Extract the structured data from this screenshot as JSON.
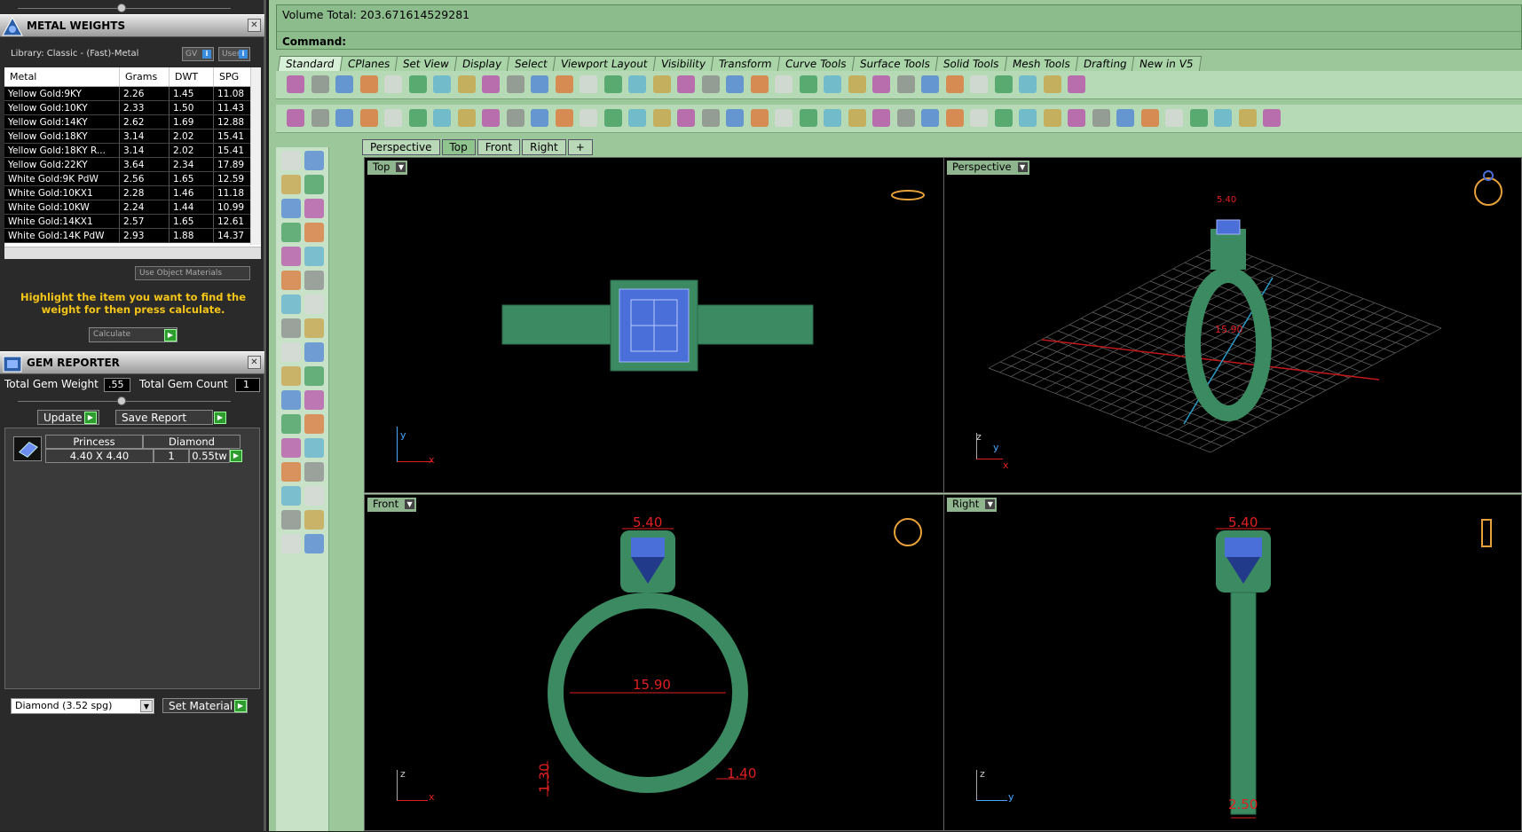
{
  "metal_panel": {
    "title": "METAL WEIGHTS",
    "library": "Library: Classic - (Fast)-Metal",
    "gv_label": "GV",
    "user_label": "User",
    "columns": [
      "Metal",
      "Grams",
      "DWT",
      "SPG"
    ],
    "rows": [
      [
        "Yellow Gold:9KY",
        "2.26",
        "1.45",
        "11.08"
      ],
      [
        "Yellow Gold:10KY",
        "2.33",
        "1.50",
        "11.43"
      ],
      [
        "Yellow Gold:14KY",
        "2.62",
        "1.69",
        "12.88"
      ],
      [
        "Yellow Gold:18KY",
        "3.14",
        "2.02",
        "15.41"
      ],
      [
        "Yellow Gold:18KY R...",
        "3.14",
        "2.02",
        "15.41"
      ],
      [
        "Yellow Gold:22KY",
        "3.64",
        "2.34",
        "17.89"
      ],
      [
        "White Gold:9K PdW",
        "2.56",
        "1.65",
        "12.59"
      ],
      [
        "White Gold:10KX1",
        "2.28",
        "1.46",
        "11.18"
      ],
      [
        "White Gold:10KW",
        "2.24",
        "1.44",
        "10.99"
      ],
      [
        "White Gold:14KX1",
        "2.57",
        "1.65",
        "12.61"
      ],
      [
        "White Gold:14K PdW",
        "2.93",
        "1.88",
        "14.37"
      ]
    ],
    "use_object_materials": "Use Object Materials",
    "hint": "Highlight the item you want to find the weight for then press calculate.",
    "calculate": "Calculate"
  },
  "gem_panel": {
    "title": "GEM REPORTER",
    "total_weight_label": "Total Gem Weight",
    "total_weight": ".55",
    "total_count_label": "Total Gem Count",
    "total_count": "1",
    "update": "Update",
    "save_report": "Save Report",
    "gem": {
      "shape": "Princess",
      "size": "4.40 X 4.40",
      "material": "Diamond",
      "count": "1",
      "tw": "0.55tw"
    },
    "material_select": "Diamond     (3.52 spg)",
    "set_material": "Set Material"
  },
  "command": {
    "volume": "Volume Total: 203.671614529281",
    "prompt": "Command:"
  },
  "toolbar_tabs": [
    "Standard",
    "CPlanes",
    "Set View",
    "Display",
    "Select",
    "Viewport Layout",
    "Visibility",
    "Transform",
    "Curve Tools",
    "Surface Tools",
    "Solid Tools",
    "Mesh Tools",
    "Drafting",
    "New in V5"
  ],
  "viewport_tabs": [
    "Perspective",
    "Top",
    "Front",
    "Right",
    "+"
  ],
  "viewports": {
    "top": {
      "label": "Top"
    },
    "perspective": {
      "label": "Perspective",
      "dims": [
        "5.40",
        "15.90"
      ]
    },
    "front": {
      "label": "Front",
      "dims": [
        "5.40",
        "15.90",
        "1.30",
        "1.40"
      ]
    },
    "right": {
      "label": "Right",
      "dims": [
        "5.40",
        "2.50"
      ]
    }
  },
  "axes": {
    "x": "x",
    "y": "y",
    "z": "z"
  },
  "colors": {
    "ring_green": "#3b8a62",
    "gem_blue": "#4a6fd8",
    "dim_red": "#e02020",
    "panel_bg": "#9bc79b"
  }
}
